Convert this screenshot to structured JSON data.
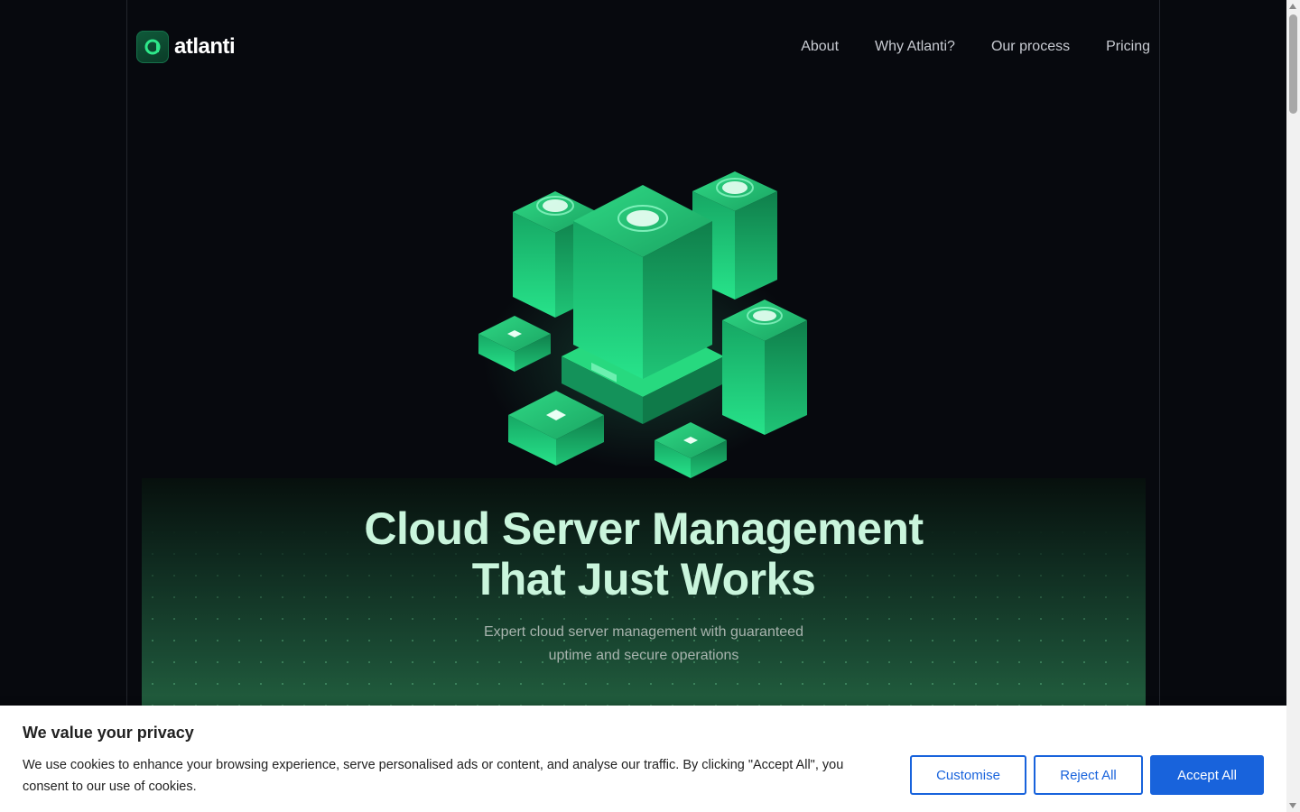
{
  "brand": {
    "name": "atlanti"
  },
  "nav": [
    {
      "label": "About"
    },
    {
      "label": "Why Atlanti?"
    },
    {
      "label": "Our process"
    },
    {
      "label": "Pricing"
    }
  ],
  "hero": {
    "title_line1": "Cloud Server Management",
    "title_line2": "That Just Works",
    "subtitle_line1": "Expert cloud server management with guaranteed",
    "subtitle_line2": "uptime and secure operations"
  },
  "cookie_banner": {
    "title": "We value your privacy",
    "text": "We use cookies to enhance your browsing experience, serve personalised ads or content, and analyse our traffic. By clicking \"Accept All\", you consent to our use of cookies.",
    "customise_label": "Customise",
    "reject_label": "Reject All",
    "accept_label": "Accept All"
  },
  "colors": {
    "accent_green": "#1fd37a",
    "hero_title": "#c9f5dc",
    "cookie_button": "#1863dc"
  },
  "icons": {
    "logo": "atlanti-logo-icon",
    "illustration": "server-cluster-illustration"
  }
}
